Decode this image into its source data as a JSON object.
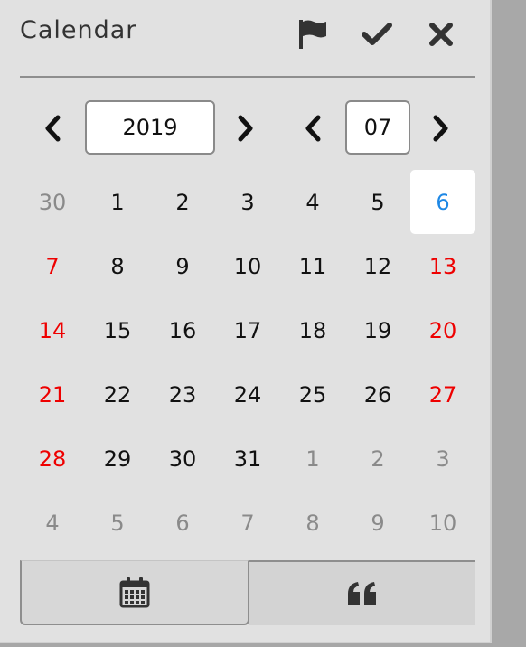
{
  "header": {
    "title": "Calendar"
  },
  "nav": {
    "year": "2019",
    "month": "07"
  },
  "calendar": {
    "weeks": [
      [
        {
          "d": "30",
          "k": "muted"
        },
        {
          "d": "1",
          "k": ""
        },
        {
          "d": "2",
          "k": ""
        },
        {
          "d": "3",
          "k": ""
        },
        {
          "d": "4",
          "k": ""
        },
        {
          "d": "5",
          "k": ""
        },
        {
          "d": "6",
          "k": "today"
        }
      ],
      [
        {
          "d": "7",
          "k": "weekend"
        },
        {
          "d": "8",
          "k": ""
        },
        {
          "d": "9",
          "k": ""
        },
        {
          "d": "10",
          "k": ""
        },
        {
          "d": "11",
          "k": ""
        },
        {
          "d": "12",
          "k": ""
        },
        {
          "d": "13",
          "k": "weekend"
        }
      ],
      [
        {
          "d": "14",
          "k": "weekend"
        },
        {
          "d": "15",
          "k": ""
        },
        {
          "d": "16",
          "k": ""
        },
        {
          "d": "17",
          "k": ""
        },
        {
          "d": "18",
          "k": ""
        },
        {
          "d": "19",
          "k": ""
        },
        {
          "d": "20",
          "k": "weekend"
        }
      ],
      [
        {
          "d": "21",
          "k": "weekend"
        },
        {
          "d": "22",
          "k": ""
        },
        {
          "d": "23",
          "k": ""
        },
        {
          "d": "24",
          "k": ""
        },
        {
          "d": "25",
          "k": ""
        },
        {
          "d": "26",
          "k": ""
        },
        {
          "d": "27",
          "k": "weekend"
        }
      ],
      [
        {
          "d": "28",
          "k": "weekend"
        },
        {
          "d": "29",
          "k": ""
        },
        {
          "d": "30",
          "k": ""
        },
        {
          "d": "31",
          "k": ""
        },
        {
          "d": "1",
          "k": "muted"
        },
        {
          "d": "2",
          "k": "muted"
        },
        {
          "d": "3",
          "k": "muted"
        }
      ],
      [
        {
          "d": "4",
          "k": "muted"
        },
        {
          "d": "5",
          "k": "muted"
        },
        {
          "d": "6",
          "k": "muted"
        },
        {
          "d": "7",
          "k": "muted"
        },
        {
          "d": "8",
          "k": "muted"
        },
        {
          "d": "9",
          "k": "muted"
        },
        {
          "d": "10",
          "k": "muted"
        }
      ]
    ]
  },
  "icons": {
    "flag": "flag-icon",
    "confirm": "check-icon",
    "close": "close-icon",
    "prev": "chevron-left-icon",
    "next": "chevron-right-icon",
    "calendar_tab": "calendar-icon",
    "quote_tab": "quote-icon"
  },
  "colors": {
    "weekend": "#ee0000",
    "today": "#1e88e5",
    "muted": "#8a8a8a",
    "panel": "#e1e1e1"
  }
}
